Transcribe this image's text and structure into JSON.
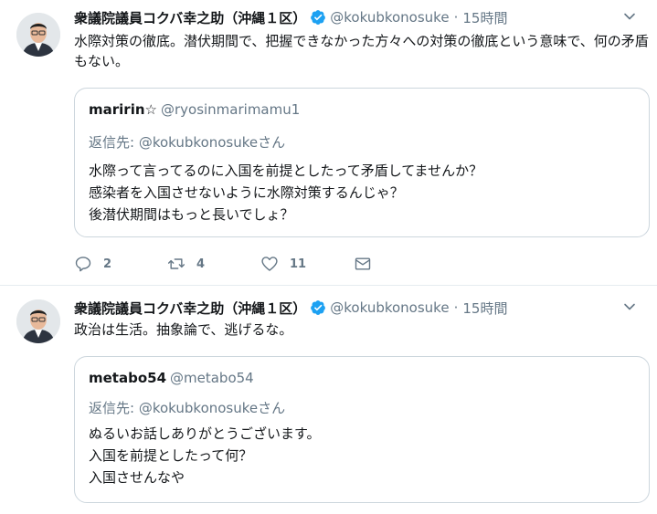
{
  "colors": {
    "verified": "#1da1f2",
    "secondary_text": "#657786",
    "border": "#ccd6dd"
  },
  "tweets": [
    {
      "author_name": "衆議院議員コクバ幸之助（沖縄１区）",
      "handle": "@kokubkonosuke",
      "separator": "·",
      "time": "15時間",
      "text": "水際対策の徹底。潜伏期間で、把握できなかった方々への対策の徹底という意味で、何の矛盾もない。",
      "quote": {
        "name": "maririn☆",
        "handle": "@ryosinmarimamu1",
        "reply_prefix": "返信先: ",
        "reply_handle": "@kokubkonosuke",
        "reply_suffix": "さん",
        "text": "水際って言ってるのに入国を前提としたって矛盾してませんか？\n感染者を入国させないように水際対策するんじゃ？\n後潜伏期間はもっと長いでしょ？"
      },
      "actions": {
        "reply_count": "2",
        "retweet_count": "4",
        "like_count": "11"
      }
    },
    {
      "author_name": "衆議院議員コクバ幸之助（沖縄１区）",
      "handle": "@kokubkonosuke",
      "separator": "·",
      "time": "15時間",
      "text": "政治は生活。抽象論で、逃げるな。",
      "quote": {
        "name": "metabo54",
        "handle": "@metabo54",
        "reply_prefix": "返信先: ",
        "reply_handle": "@kokubkonosuke",
        "reply_suffix": "さん",
        "text": "ぬるいお話しありがとうございます。\n入国を前提としたって何？\n入国させんなや"
      }
    }
  ]
}
